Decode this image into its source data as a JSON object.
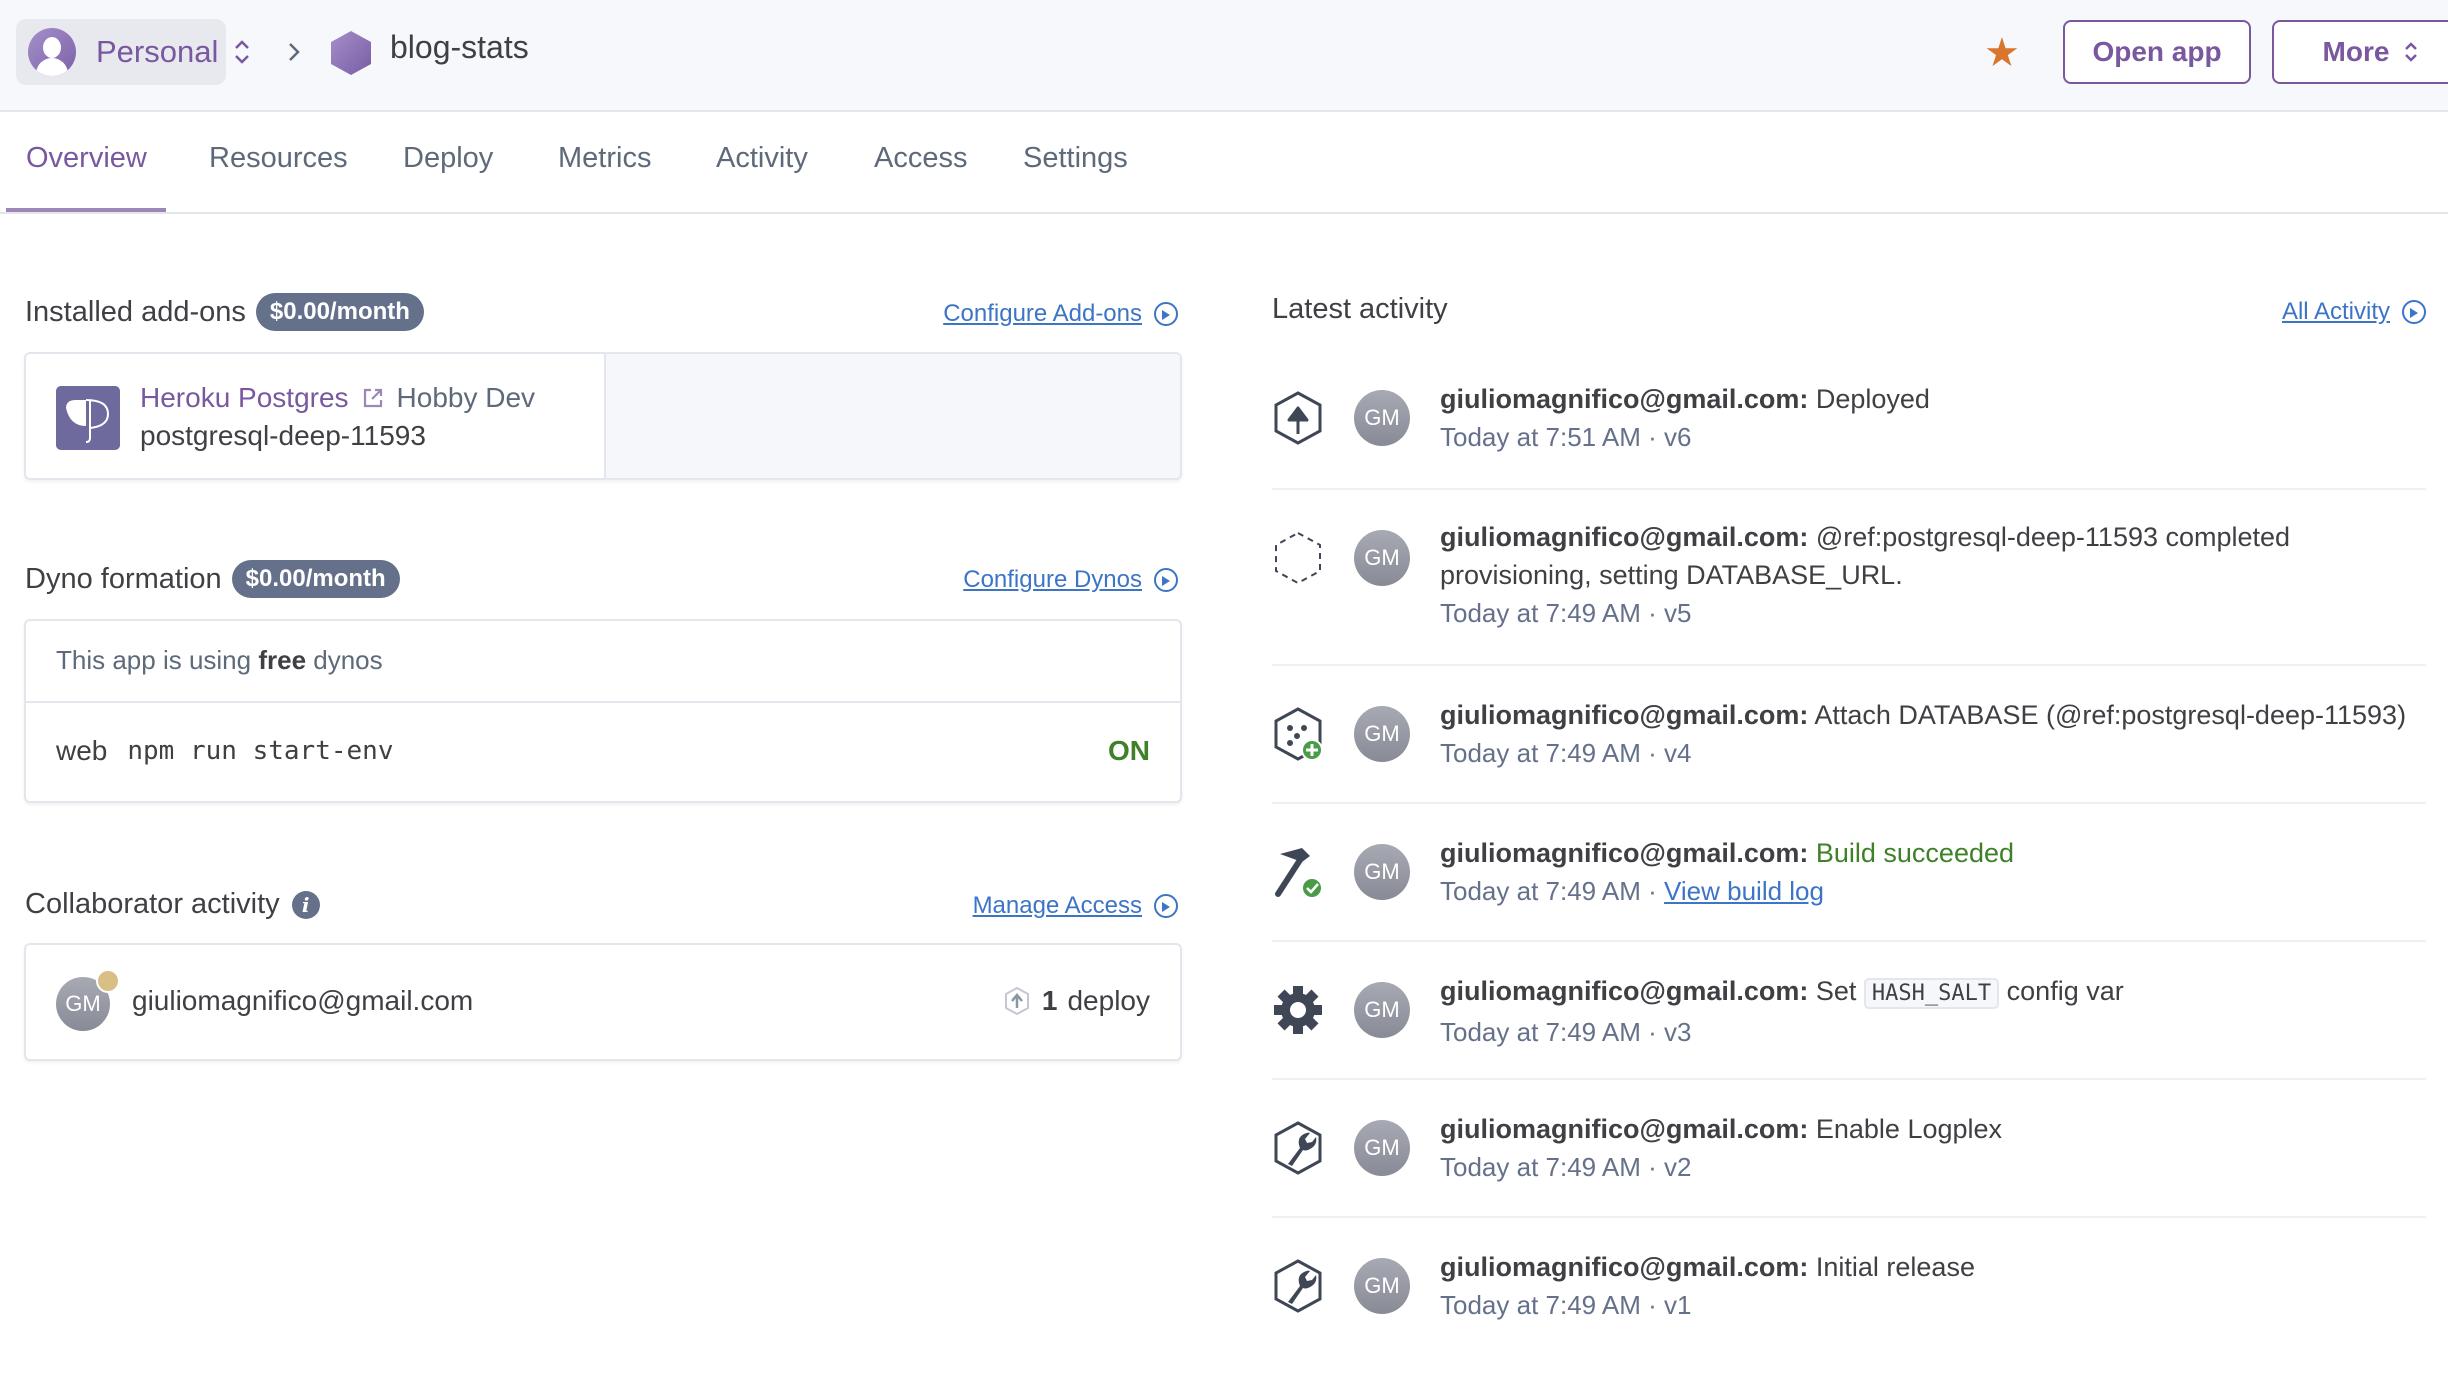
{
  "header": {
    "account_label": "Personal",
    "app_name": "blog-stats",
    "open_app_label": "Open app",
    "more_label": "More",
    "star_glyph": "★"
  },
  "tabs": [
    {
      "label": "Overview",
      "active": true
    },
    {
      "label": "Resources"
    },
    {
      "label": "Deploy"
    },
    {
      "label": "Metrics"
    },
    {
      "label": "Activity"
    },
    {
      "label": "Access"
    },
    {
      "label": "Settings"
    }
  ],
  "addons": {
    "title": "Installed add-ons",
    "price": "$0.00/month",
    "link": "Configure Add-ons",
    "items": [
      {
        "name": "Heroku Postgres",
        "plan": "Hobby Dev",
        "id": "postgresql-deep-11593"
      }
    ]
  },
  "dynos": {
    "title": "Dyno formation",
    "price": "$0.00/month",
    "link": "Configure Dynos",
    "info_prefix": "This app is using ",
    "info_bold": "free",
    "info_suffix": " dynos",
    "rows": [
      {
        "type": "web",
        "command": "npm run start-env",
        "status": "ON"
      }
    ]
  },
  "collaborators": {
    "title": "Collaborator activity",
    "link": "Manage Access",
    "items": [
      {
        "initials": "GM",
        "email": "giuliomagnifico@gmail.com",
        "count": "1",
        "unit": "deploy"
      }
    ]
  },
  "activity": {
    "title": "Latest activity",
    "link": "All Activity",
    "items": [
      {
        "icon": "deploy-icon",
        "initials": "GM",
        "user": "giuliomagnifico@gmail.com:",
        "text": "Deployed",
        "time": "Today at 7:51 AM",
        "version": "v6"
      },
      {
        "icon": "provisioning-icon",
        "initials": "GM",
        "user": "giuliomagnifico@gmail.com:",
        "text": "@ref:postgresql-deep-11593 completed provisioning, setting DATABASE_URL.",
        "time": "Today at 7:49 AM",
        "version": "v5"
      },
      {
        "icon": "addon-attach-icon",
        "initials": "GM",
        "user": "giuliomagnifico@gmail.com:",
        "text": "Attach DATABASE (@ref:postgresql-deep-11593)",
        "time": "Today at 7:49 AM",
        "version": "v4"
      },
      {
        "icon": "build-success-icon",
        "initials": "GM",
        "user": "giuliomagnifico@gmail.com:",
        "text": "Build succeeded",
        "time": "Today at 7:49 AM",
        "link": "View build log"
      },
      {
        "icon": "gear-icon",
        "initials": "GM",
        "user": "giuliomagnifico@gmail.com:",
        "text_prefix": "Set",
        "code": "HASH_SALT",
        "text_suffix": "config var",
        "time": "Today at 7:49 AM",
        "version": "v3"
      },
      {
        "icon": "wrench-icon",
        "initials": "GM",
        "user": "giuliomagnifico@gmail.com:",
        "text": "Enable Logplex",
        "time": "Today at 7:49 AM",
        "version": "v2"
      },
      {
        "icon": "wrench-icon",
        "initials": "GM",
        "user": "giuliomagnifico@gmail.com:",
        "text": "Initial release",
        "time": "Today at 7:49 AM",
        "version": "v1"
      }
    ]
  },
  "meta_separator": " · "
}
